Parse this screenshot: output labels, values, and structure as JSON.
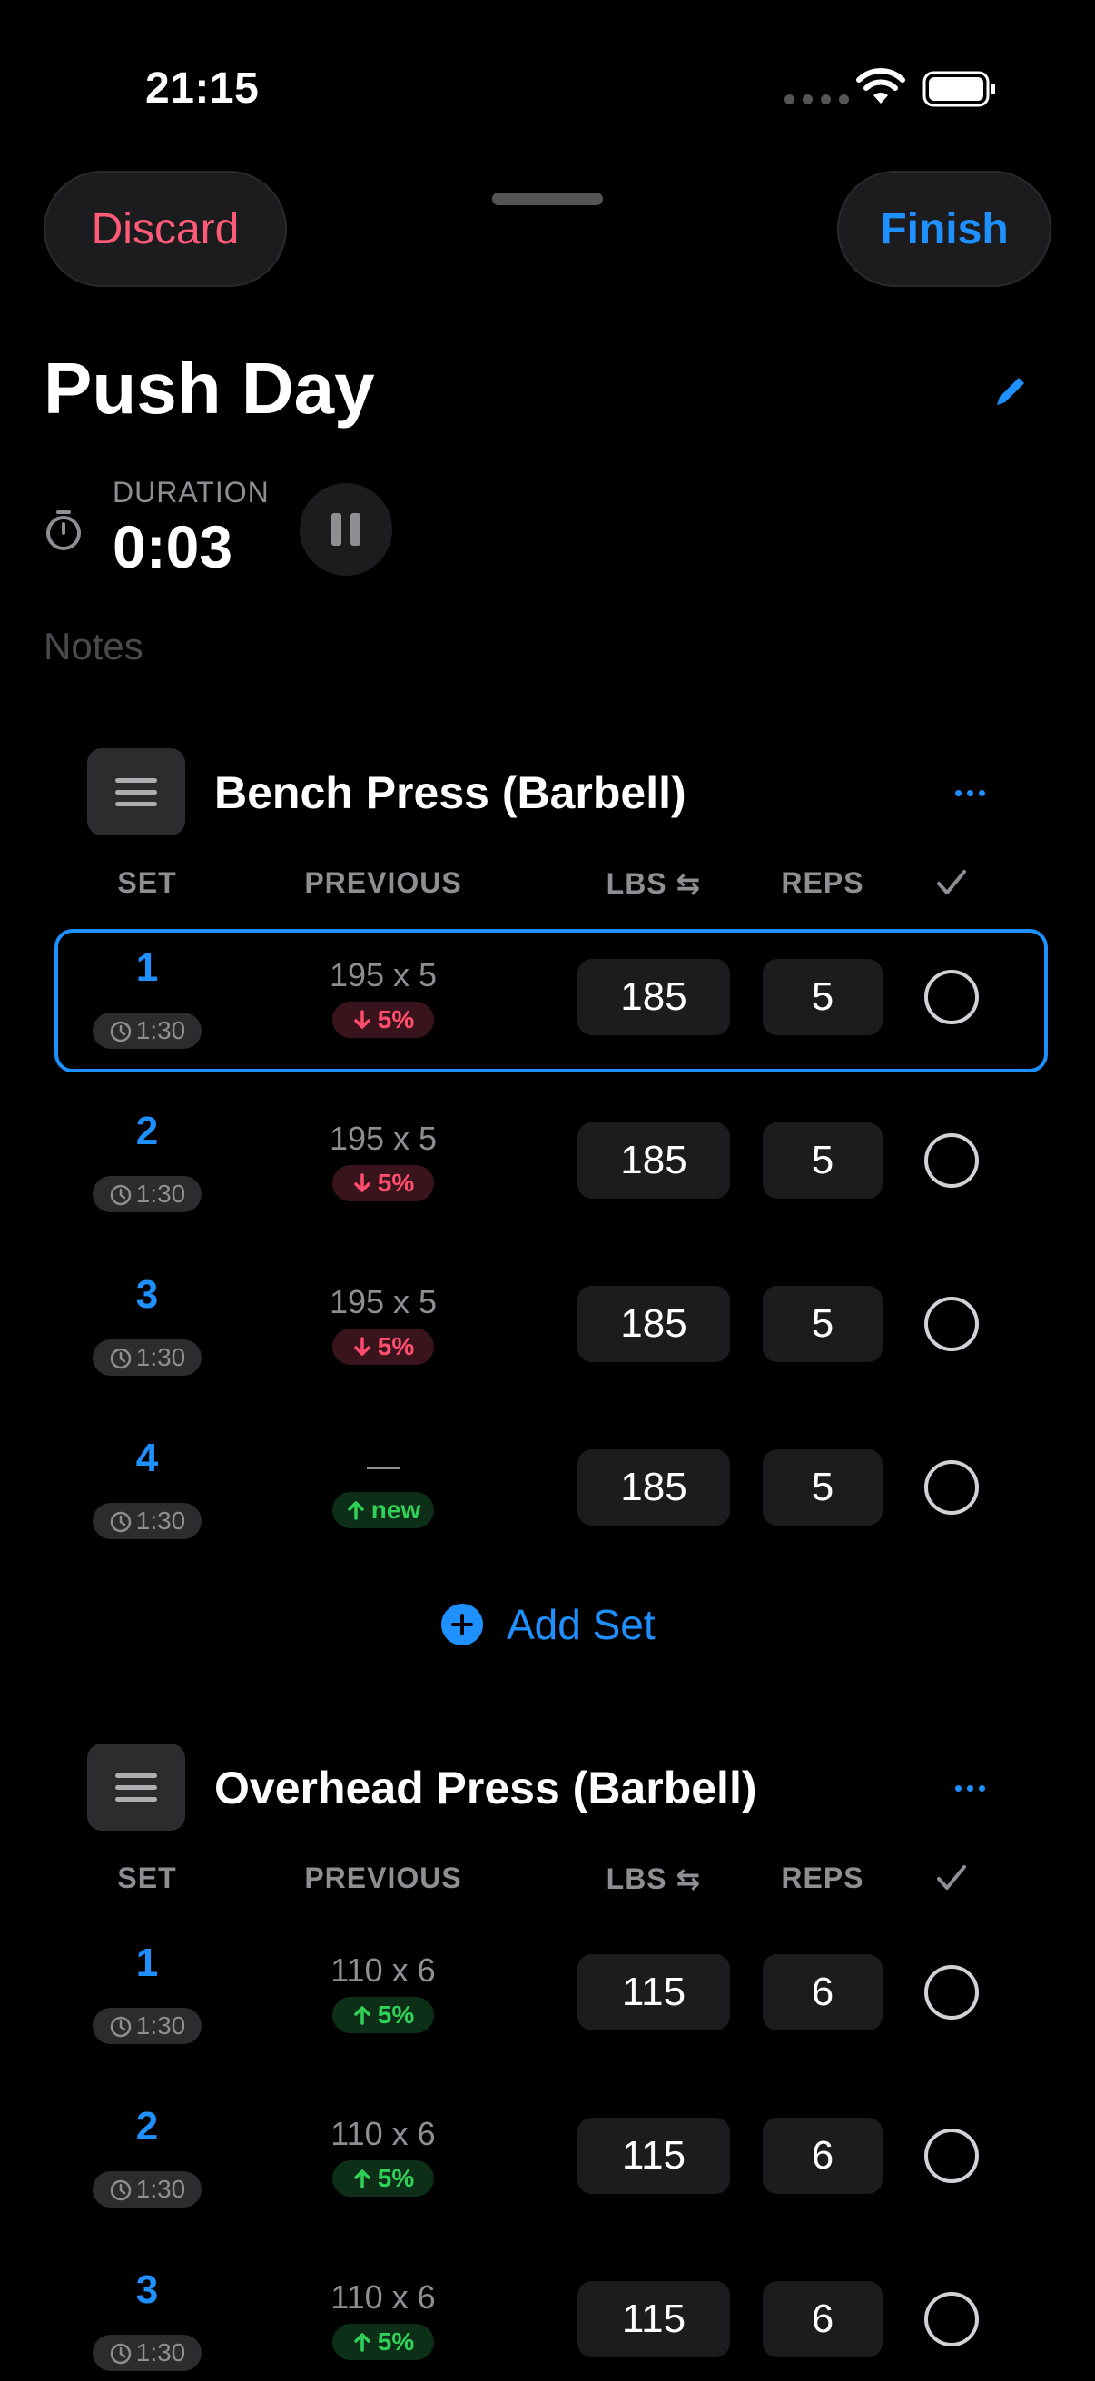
{
  "status_bar": {
    "time": "21:15"
  },
  "header": {
    "discard_label": "Discard",
    "finish_label": "Finish"
  },
  "workout": {
    "title": "Push Day",
    "duration_label": "DURATION",
    "duration_value": "0:03",
    "notes_placeholder": "Notes"
  },
  "columns": {
    "set": "SET",
    "previous": "PREVIOUS",
    "lbs": "LBS ⇆",
    "reps": "REPS"
  },
  "add_set_label": "Add Set",
  "colors": {
    "accent": "#1e90ff",
    "danger": "#ff5a77",
    "up": "#30d158",
    "down": "#ff4d6d"
  },
  "exercises": [
    {
      "name": "Bench Press (Barbell)",
      "sets": [
        {
          "num": "1",
          "rest": "1:30",
          "previous": "195 x 5",
          "delta": "5%",
          "trend": "down",
          "lbs": "185",
          "reps": "5",
          "active": true
        },
        {
          "num": "2",
          "rest": "1:30",
          "previous": "195 x 5",
          "delta": "5%",
          "trend": "down",
          "lbs": "185",
          "reps": "5"
        },
        {
          "num": "3",
          "rest": "1:30",
          "previous": "195 x 5",
          "delta": "5%",
          "trend": "down",
          "lbs": "185",
          "reps": "5"
        },
        {
          "num": "4",
          "rest": "1:30",
          "previous": "—",
          "delta": "new",
          "trend": "up",
          "lbs": "185",
          "reps": "5"
        }
      ]
    },
    {
      "name": "Overhead Press (Barbell)",
      "sets": [
        {
          "num": "1",
          "rest": "1:30",
          "previous": "110 x 6",
          "delta": "5%",
          "trend": "up",
          "lbs": "115",
          "reps": "6"
        },
        {
          "num": "2",
          "rest": "1:30",
          "previous": "110 x 6",
          "delta": "5%",
          "trend": "up",
          "lbs": "115",
          "reps": "6"
        },
        {
          "num": "3",
          "rest": "1:30",
          "previous": "110 x 6",
          "delta": "5%",
          "trend": "up",
          "lbs": "115",
          "reps": "6"
        }
      ]
    }
  ]
}
